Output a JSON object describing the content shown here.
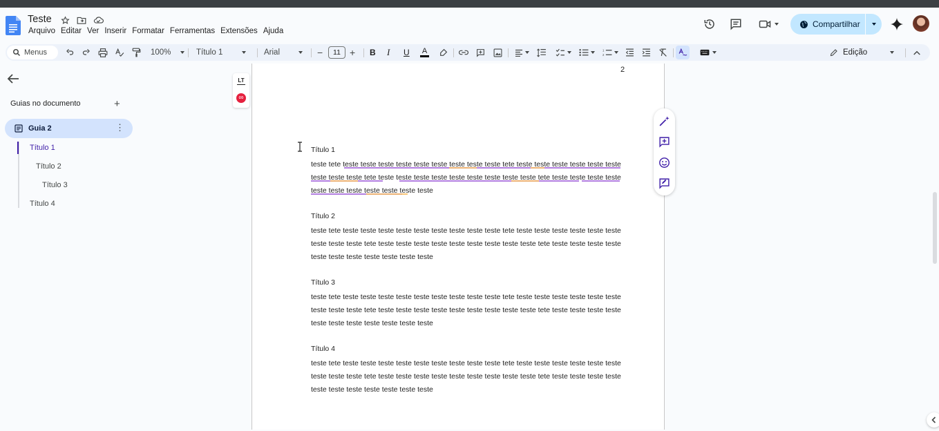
{
  "app": {
    "title": "Teste",
    "menu": [
      "Arquivo",
      "Editar",
      "Ver",
      "Inserir",
      "Formatar",
      "Ferramentas",
      "Extensões",
      "Ajuda"
    ]
  },
  "header": {
    "share_label": "Compartilhar",
    "colors": {
      "share_bg": "#c2e7ff",
      "doc_blue": "#4285f4"
    }
  },
  "toolbar": {
    "search_label": "Menus",
    "zoom": "100%",
    "style": "Título 1",
    "font": "Arial",
    "font_size": "11",
    "mode": "Edição"
  },
  "sidebar": {
    "section_label": "Guias no documento",
    "tab_label": "Guia 2",
    "outline": [
      "Título 1",
      "Título 2",
      "Título 3",
      "Título 4"
    ]
  },
  "document": {
    "page_number": "2",
    "sections": [
      {
        "heading": "Título 1",
        "paragraph": "teste tete teste teste teste teste teste teste teste teste teste tete teste teste teste teste teste teste teste teste teste tete teste teste teste teste teste teste teste teste teste tete teste teste teste teste teste teste teste teste teste teste teste"
      },
      {
        "heading": "Título 2",
        "paragraph": "teste tete teste teste teste teste teste teste teste teste teste tete teste teste teste teste teste teste teste teste teste tete teste teste teste teste teste teste teste teste teste tete teste teste teste teste teste teste teste teste teste teste teste"
      },
      {
        "heading": "Título 3",
        "paragraph": "teste tete teste teste teste teste teste teste teste teste teste tete teste teste teste teste teste teste teste teste teste tete teste teste teste teste teste teste teste teste teste tete teste teste teste teste teste teste teste teste teste teste teste"
      },
      {
        "heading": "Título 4",
        "paragraph": "teste tete teste teste teste teste teste teste teste teste teste tete teste teste teste teste teste teste teste teste teste tete teste teste teste teste teste teste teste teste teste tete teste teste teste teste teste teste teste teste teste teste teste"
      }
    ]
  },
  "icons": {
    "history": "history-icon",
    "comments": "comments-icon",
    "meet": "video-camera-icon",
    "globe": "globe-icon",
    "gemini": "gemini-spark-icon"
  }
}
